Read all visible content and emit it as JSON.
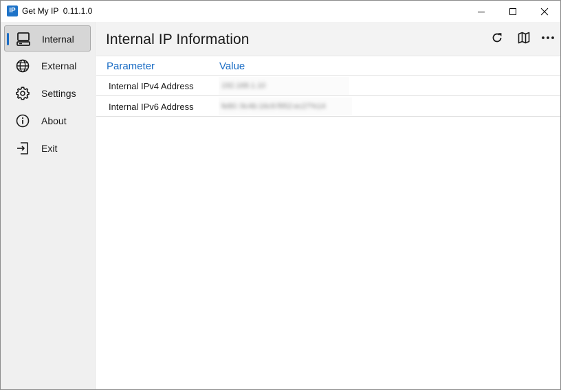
{
  "window": {
    "icon_text": "IP",
    "title": "Get My IP  0.11.1.0"
  },
  "sidebar": {
    "items": [
      {
        "label": "Internal",
        "icon": "computer-icon",
        "active": true
      },
      {
        "label": "External",
        "icon": "globe-icon",
        "active": false
      },
      {
        "label": "Settings",
        "icon": "gear-icon",
        "active": false
      },
      {
        "label": "About",
        "icon": "info-icon",
        "active": false
      },
      {
        "label": "Exit",
        "icon": "exit-icon",
        "active": false
      }
    ]
  },
  "main": {
    "title": "Internal IP Information",
    "actions": [
      "refresh-icon",
      "map-icon",
      "more-icon"
    ],
    "table": {
      "columns": [
        "Parameter",
        "Value"
      ],
      "rows": [
        {
          "parameter": "Internal IPv4 Address",
          "value": "192.168.1.10"
        },
        {
          "parameter": "Internal IPv6 Address",
          "value": "fe80::9c4b:16c9:f952:ec27%14"
        }
      ]
    }
  },
  "colors": {
    "accent": "#1a6cc4",
    "sidebar_bg": "#f0f0f0",
    "active_item_bg": "#d6d6d6",
    "header_bg": "#f3f3f3"
  }
}
